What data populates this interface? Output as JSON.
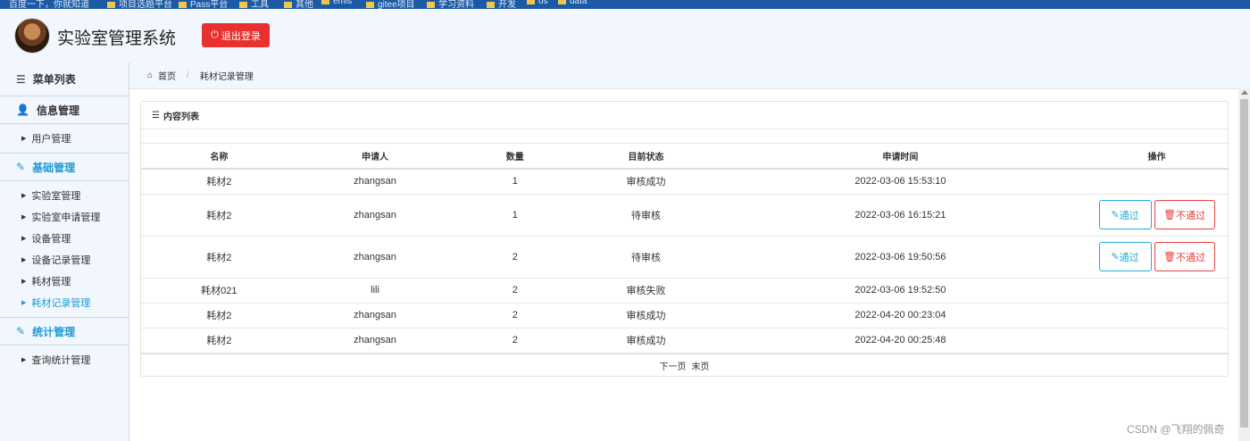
{
  "bookmarks": [
    "百度一下，你就知道",
    "项目选题平台",
    "Pass平台",
    "工具",
    "其他",
    "emis",
    "gitee项目",
    "学习资料",
    "开发",
    "os",
    "data"
  ],
  "header": {
    "app_title": "实验室管理系统",
    "logout_label": "退出登录"
  },
  "sidebar": {
    "menu_title": "菜单列表",
    "groups": [
      {
        "label": "信息管理",
        "items": [
          "用户管理"
        ]
      },
      {
        "label": "基础管理",
        "items": [
          "实验室管理",
          "实验室申请管理",
          "设备管理",
          "设备记录管理",
          "耗材管理",
          "耗材记录管理"
        ]
      },
      {
        "label": "统计管理",
        "items": [
          "查询统计管理"
        ]
      }
    ]
  },
  "breadcrumb": {
    "home": "首页",
    "current": "耗材记录管理"
  },
  "panel": {
    "title": "内容列表"
  },
  "table": {
    "headers": [
      "名称",
      "申请人",
      "数量",
      "目前状态",
      "申请时间",
      "操作"
    ],
    "rows": [
      {
        "name": "耗材2",
        "applicant": "zhangsan",
        "qty": "1",
        "status": "审核成功",
        "time": "2022-03-06 15:53:10"
      },
      {
        "name": "耗材2",
        "applicant": "zhangsan",
        "qty": "1",
        "status": "待审核",
        "time": "2022-03-06 16:15:21",
        "pass": "通过",
        "fail": "不通过"
      },
      {
        "name": "耗材2",
        "applicant": "zhangsan",
        "qty": "2",
        "status": "待审核",
        "time": "2022-03-06 19:50:56",
        "pass": "通过",
        "fail": "不通过"
      },
      {
        "name": "耗材021",
        "applicant": "lili",
        "qty": "2",
        "status": "审核失败",
        "time": "2022-03-06 19:52:50"
      },
      {
        "name": "耗材2",
        "applicant": "zhangsan",
        "qty": "2",
        "status": "审核成功",
        "time": "2022-04-20 00:23:04"
      },
      {
        "name": "耗材2",
        "applicant": "zhangsan",
        "qty": "2",
        "status": "审核成功",
        "time": "2022-04-20 00:25:48"
      }
    ]
  },
  "pager": {
    "next": "下一页",
    "last": "末页"
  },
  "watermark": "CSDN @飞翔的佩奇",
  "colors": {
    "accent": "#1e9ad6",
    "danger": "#e8312f",
    "topbar": "#1c5aa6"
  }
}
